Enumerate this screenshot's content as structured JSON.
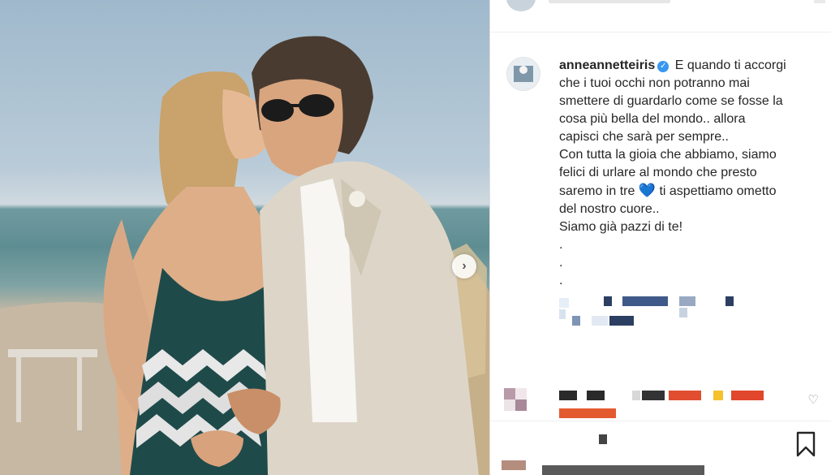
{
  "post": {
    "username": "anneannetteiris",
    "verified_badge_icon": "verified-badge-icon",
    "caption_lines": [
      "E quando ti accorgi",
      "che i tuoi occhi non potranno mai",
      "smettere di guardarlo come se fosse la",
      "cosa più bella del mondo.. allora",
      "capisci che sarà per sempre..",
      "Con tutta la gioia che abbiamo, siamo",
      "felici di urlare al mondo che presto",
      "saremo in tre",
      "ti aspettiamo ometto",
      "del nostro cuore..",
      "Siamo già pazzi di te!",
      ".",
      ".",
      "."
    ],
    "heart_emoji": "💙"
  },
  "photo": {
    "carousel_next_icon": "chevron-right-icon",
    "carousel_next_label": "›"
  },
  "actions": {
    "like_icon": "heart-outline-icon",
    "like_glyph": "♡",
    "bookmark_icon": "bookmark-icon"
  },
  "colors": {
    "accent_verified": "#3897f0",
    "text": "#262626",
    "divider": "#efefef"
  }
}
